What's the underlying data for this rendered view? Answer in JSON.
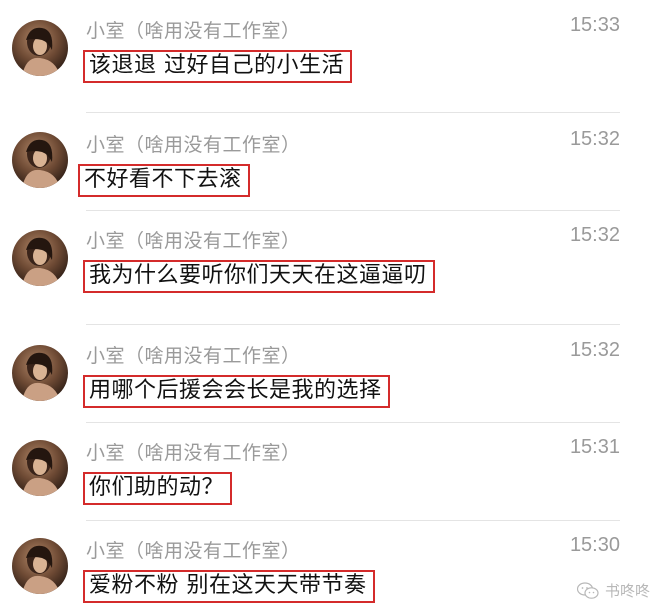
{
  "messages": [
    {
      "sender": "小室（啥用没有工作室）",
      "time": "15:33",
      "text": "该退退 过好自己的小生活"
    },
    {
      "sender": "小室（啥用没有工作室）",
      "time": "15:32",
      "text": "不好看不下去滚"
    },
    {
      "sender": "小室（啥用没有工作室）",
      "time": "15:32",
      "text": "我为什么要听你们天天在这逼逼叨"
    },
    {
      "sender": "小室（啥用没有工作室）",
      "time": "15:32",
      "text": "用哪个后援会会长是我的选择"
    },
    {
      "sender": "小室（啥用没有工作室）",
      "time": "15:31",
      "text": "你们助的动？"
    },
    {
      "sender": "小室（啥用没有工作室）",
      "time": "15:30",
      "text": "爱粉不粉 别在这天天带节奏"
    }
  ],
  "watermark": {
    "text": "书咚咚",
    "icon": "wechat-icon"
  },
  "colors": {
    "highlight_border": "#d42b2b",
    "meta_text": "#9a9a9a",
    "message_text": "#111111"
  }
}
